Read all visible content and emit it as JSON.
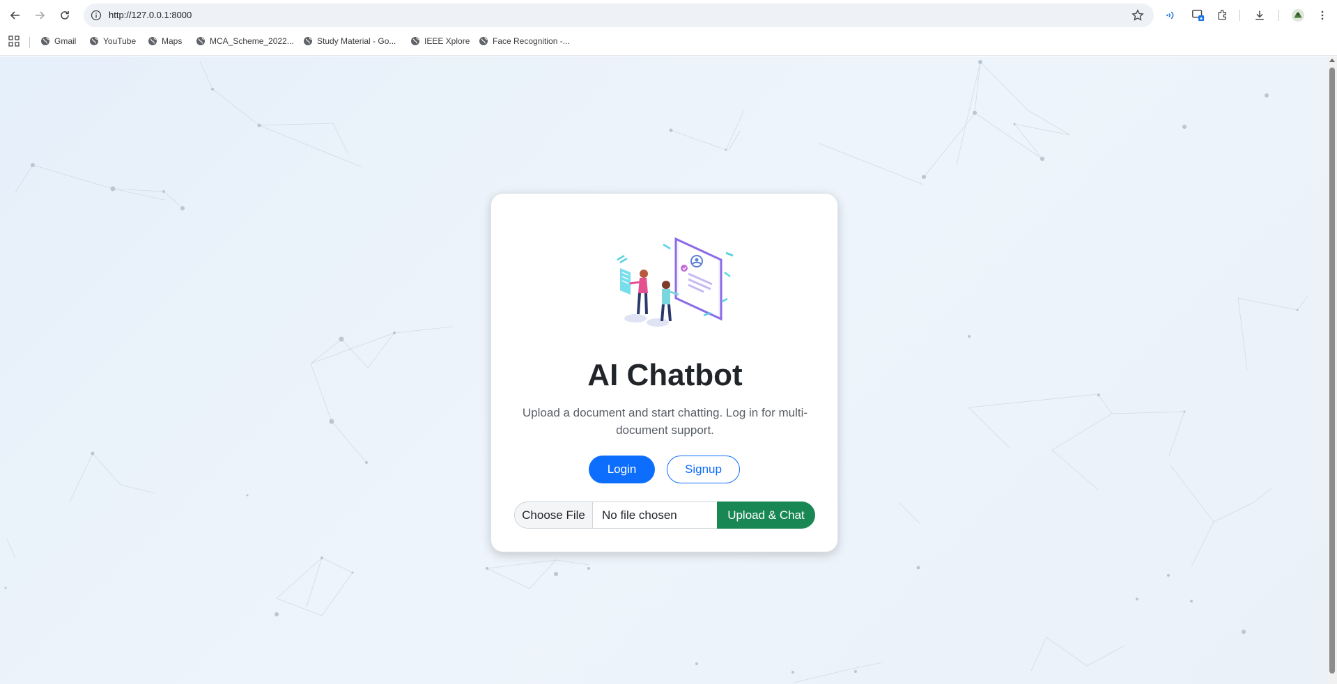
{
  "browser": {
    "url": "http://127.0.0.1:8000",
    "bookmarks": [
      {
        "label": "Gmail"
      },
      {
        "label": "YouTube"
      },
      {
        "label": "Maps"
      },
      {
        "label": "MCA_Scheme_2022..."
      },
      {
        "label": "Study Material - Go..."
      },
      {
        "label": "IEEE Xplore"
      },
      {
        "label": "Face Recognition -..."
      }
    ]
  },
  "card": {
    "title": "AI Chatbot",
    "subtitle": "Upload a document and start chatting. Log in for multi-document support.",
    "login_label": "Login",
    "signup_label": "Signup",
    "choose_file_label": "Choose File",
    "file_status": "No file chosen",
    "upload_label": "Upload & Chat"
  },
  "colors": {
    "primary": "#0d6efd",
    "success": "#198754",
    "background": "#e9f2fa"
  }
}
